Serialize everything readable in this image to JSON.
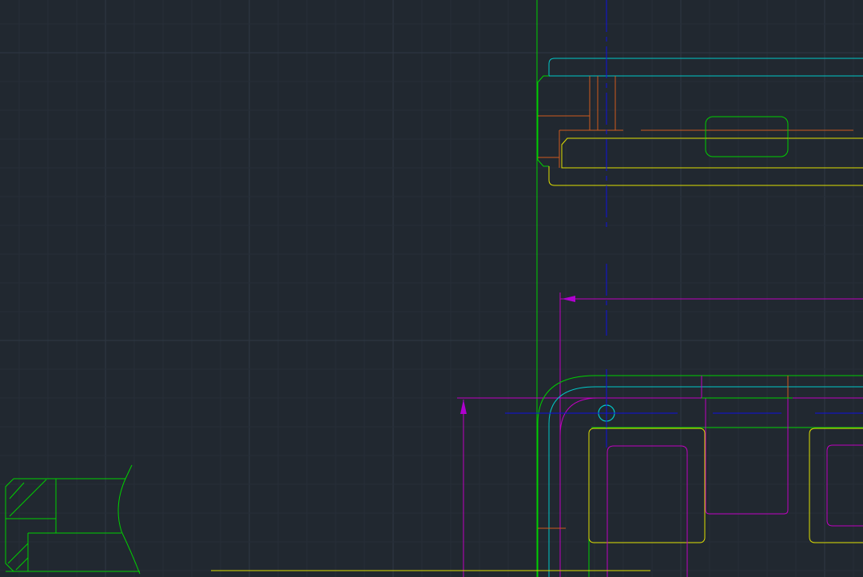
{
  "app": {
    "view": "model-space",
    "background": "#212830"
  },
  "colors": {
    "grid_minor": "#262e38",
    "grid_major": "#2f3843",
    "green": "#00d000",
    "cyan": "#00c8c8",
    "yellow": "#e0e000",
    "magenta": "#c000c0",
    "orange": "#d05a1e",
    "blue": "#1010e0",
    "dimension_arrow": "#b000d0"
  },
  "layers": [
    {
      "name": "outline",
      "color": "green"
    },
    {
      "name": "offset-profile",
      "color": "cyan"
    },
    {
      "name": "part-edges",
      "color": "yellow"
    },
    {
      "name": "dimensions",
      "color": "magenta"
    },
    {
      "name": "hidden-details",
      "color": "orange"
    },
    {
      "name": "centerlines",
      "color": "blue"
    }
  ],
  "annotations": []
}
